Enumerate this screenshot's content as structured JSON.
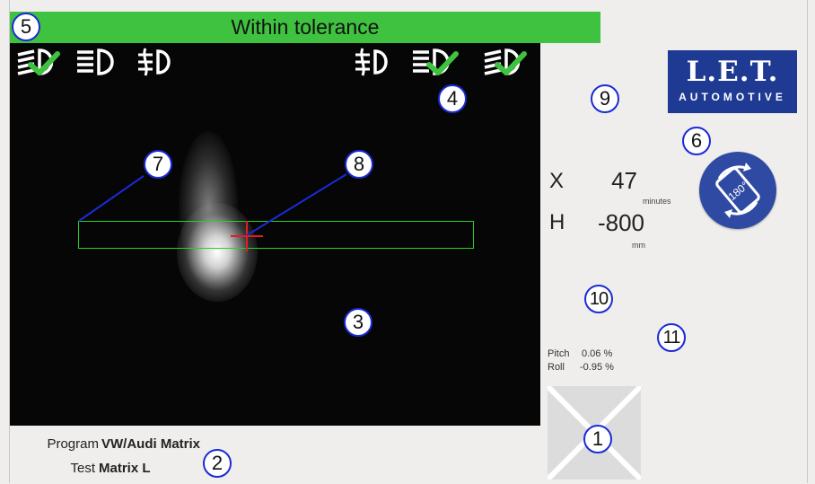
{
  "status": {
    "text": "Within tolerance",
    "color": "#3fc23f"
  },
  "lamps": {
    "left": [
      {
        "icon": "low-beam-icon",
        "checked": true
      },
      {
        "icon": "high-beam-icon",
        "checked": false
      },
      {
        "icon": "fog-lamp-icon",
        "checked": false
      }
    ],
    "right": [
      {
        "icon": "fog-lamp-icon",
        "checked": false
      },
      {
        "icon": "high-beam-icon",
        "checked": true
      },
      {
        "icon": "low-beam-icon",
        "checked": true
      }
    ]
  },
  "logo": {
    "main": "L.E.T.",
    "sub": "AUTOMOTIVE",
    "color": "#1f3a93"
  },
  "rotate_button": {
    "label": "180°",
    "icon": "rotate-180-icon"
  },
  "measurements": {
    "x": {
      "label": "X",
      "value": "47",
      "unit": "minutes"
    },
    "h": {
      "label": "H",
      "value": "-800",
      "unit": "mm"
    }
  },
  "tilt": {
    "pitch": {
      "label": "Pitch",
      "value": "0.06 %"
    },
    "roll": {
      "label": "Roll",
      "value": "-0.95 %"
    }
  },
  "program": {
    "program_label": "Program",
    "program_value": "VW/Audi Matrix",
    "test_label": "Test",
    "test_value": "Matrix L"
  },
  "markers": {
    "m1": "1",
    "m2": "2",
    "m3": "3",
    "m4": "4",
    "m5": "5",
    "m6": "6",
    "m7": "7",
    "m8": "8",
    "m9": "9",
    "m10": "10",
    "m11": "11"
  },
  "colors": {
    "tolerance_box": "#28d028",
    "crosshair": "#e0201c",
    "marker_border": "#1a2bd6",
    "check": "#3fc23f"
  }
}
